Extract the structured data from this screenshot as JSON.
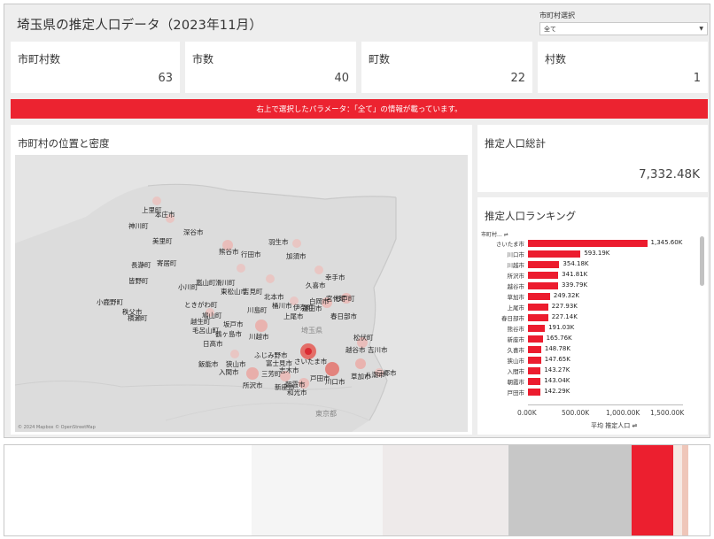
{
  "header": {
    "title": "埼玉県の推定人口データ（2023年11月）"
  },
  "filter": {
    "label": "市町村選択",
    "value": "全て"
  },
  "kpis": [
    {
      "label": "市町村数",
      "value": "63"
    },
    {
      "label": "市数",
      "value": "40"
    },
    {
      "label": "町数",
      "value": "22"
    },
    {
      "label": "村数",
      "value": "1"
    }
  ],
  "banner": "右上で選択したパラメータ：「全て」の情報が載っています。",
  "map": {
    "title": "市町村の位置と密度",
    "credit": "© 2024 Mapbox © OpenStreetMap",
    "region_label": "埼玉県",
    "tokyo_label": "東京都",
    "cities": [
      "上里町",
      "本庄市",
      "神川町",
      "深谷市",
      "美里町",
      "熊谷市",
      "行田市",
      "羽生市",
      "加須市",
      "長瀞町",
      "寄居町",
      "皆野町",
      "幸手市",
      "小川町",
      "嵐山町",
      "滑川町",
      "東松山市",
      "吉見町",
      "北本市",
      "久喜市",
      "白岡市",
      "宮代町",
      "杉戸町",
      "小鹿野町",
      "ときがわ町",
      "川島町",
      "桶川市",
      "伊奈町",
      "上尾市",
      "蓮田市",
      "春日部市",
      "秩父市",
      "横瀬町",
      "鳩山町",
      "越生町",
      "坂戸市",
      "毛呂山町",
      "鶴ヶ島市",
      "川越市",
      "日高市",
      "松伏町",
      "越谷市",
      "吉川市",
      "飯能市",
      "狭山市",
      "ふじみ野市",
      "富士見市",
      "志木市",
      "さいたま市",
      "入間市",
      "所沢市",
      "三芳町",
      "新座市",
      "朝霞市",
      "和光市",
      "戸田市",
      "川口市",
      "草加市",
      "八潮市",
      "三郷市"
    ]
  },
  "total": {
    "title": "推定人口総計",
    "value": "7,332.48K"
  },
  "ranking": {
    "title": "推定人口ランキング",
    "column_header": "市町村...",
    "rows": [
      {
        "name": "さいたま市",
        "value": 1345.6,
        "label": "1,345.60K"
      },
      {
        "name": "川口市",
        "value": 593.19,
        "label": "593.19K"
      },
      {
        "name": "川越市",
        "value": 354.18,
        "label": "354.18K"
      },
      {
        "name": "所沢市",
        "value": 341.81,
        "label": "341.81K"
      },
      {
        "name": "越谷市",
        "value": 339.79,
        "label": "339.79K"
      },
      {
        "name": "草加市",
        "value": 249.32,
        "label": "249.32K"
      },
      {
        "name": "上尾市",
        "value": 227.93,
        "label": "227.93K"
      },
      {
        "name": "春日部市",
        "value": 227.14,
        "label": "227.14K"
      },
      {
        "name": "熊谷市",
        "value": 191.03,
        "label": "191.03K"
      },
      {
        "name": "新座市",
        "value": 165.76,
        "label": "165.76K"
      },
      {
        "name": "久喜市",
        "value": 148.78,
        "label": "148.78K"
      },
      {
        "name": "狭山市",
        "value": 147.65,
        "label": "147.65K"
      },
      {
        "name": "入間市",
        "value": 143.27,
        "label": "143.27K"
      },
      {
        "name": "朝霞市",
        "value": 143.04,
        "label": "143.04K"
      },
      {
        "name": "戸田市",
        "value": 142.29,
        "label": "142.29K"
      }
    ],
    "axis_max": 1750,
    "axis_ticks": [
      "0.00K",
      "500.00K",
      "1,000.00K",
      "1,500.00K"
    ],
    "axis_tick_values": [
      0,
      500,
      1000,
      1500
    ],
    "axis_title": "平均 推定人口"
  },
  "palette": {
    "swatches": [
      {
        "color": "#ffffff",
        "weight": 280
      },
      {
        "color": "#f5f5f5",
        "weight": 148
      },
      {
        "color": "#eeeaea",
        "weight": 142
      },
      {
        "color": "#c7c7c7",
        "weight": 140
      },
      {
        "color": "#ec1f2f",
        "weight": 47
      },
      {
        "color": "#f6e9e3",
        "weight": 10
      },
      {
        "color": "#efc6b9",
        "weight": 7
      },
      {
        "color": "#ffffff",
        "weight": 24
      }
    ]
  }
}
